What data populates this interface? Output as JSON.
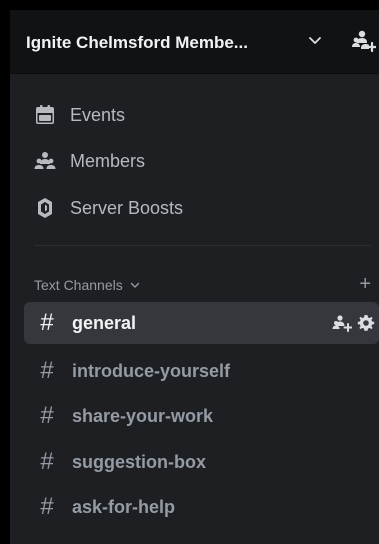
{
  "server": {
    "name": "Ignite Chelmsford Membe...",
    "icons": {
      "chevron": "chevron-down-icon",
      "invite": "add-member-icon"
    }
  },
  "nav": [
    {
      "label": "Events",
      "icon": "calendar-icon"
    },
    {
      "label": "Members",
      "icon": "members-icon"
    },
    {
      "label": "Server Boosts",
      "icon": "boost-icon"
    }
  ],
  "category": {
    "label": "Text Channels",
    "add_symbol": "+"
  },
  "channels": [
    {
      "label": "general",
      "active": true
    },
    {
      "label": "introduce-yourself",
      "active": false
    },
    {
      "label": "share-your-work",
      "active": false
    },
    {
      "label": "suggestion-box",
      "active": false
    },
    {
      "label": "ask-for-help",
      "active": false
    }
  ],
  "channel_hash": "#",
  "colors": {
    "background": "#1e1f22",
    "header": "#111214",
    "active_channel": "#35373c",
    "text_primary": "#f2f3f5",
    "text_muted": "#949ba4"
  }
}
